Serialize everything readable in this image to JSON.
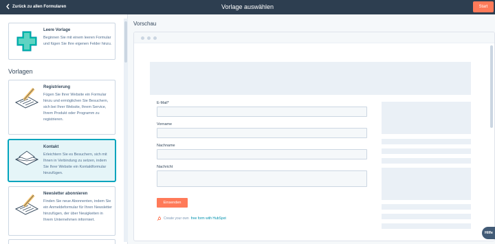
{
  "header": {
    "back_label": "Zurück zu allen Formularen",
    "title": "Vorlage auswählen",
    "start_label": "Start"
  },
  "left": {
    "top_card": {
      "title": "Leere Vorlage",
      "description": "Beginnen Sie mit einem leeren Formular und fügen Sie Ihre eigenen Felder hinzu."
    },
    "section_title": "Vorlagen",
    "cards": [
      {
        "title": "Registrierung",
        "description": "Fügen Sie Ihrer Website ein Formular hinzu und ermöglichen Sie Besuchern, sich bei Ihrer Website, Ihrem Service, Ihrem Produkt oder Programm zu registrieren."
      },
      {
        "title": "Kontakt",
        "description": "Erleichtern Sie es Besuchern, sich mit Ihnen in Verbindung zu setzen, indem Sie Ihrer Website ein Kontaktformular hinzufügen."
      },
      {
        "title": "Newsletter abonnieren",
        "description": "Finden Sie neue Abonnenten, indem Sie ein Anmeldeformular für Ihren Newsletter hinzufügen, der über Neuigkeiten in Ihrem Unternehmen informiert."
      }
    ]
  },
  "preview": {
    "heading": "Vorschau",
    "fields": [
      "E-Mail*",
      "Vorname",
      "Nachname",
      "Nachricht"
    ],
    "submit_label": "Einsenden",
    "credit_prefix": "Create your own",
    "credit_link": "free form with HubSpot"
  },
  "help_label": "Hilfe",
  "colors": {
    "header": "#2d3e50",
    "accent": "#ff7a59",
    "selected": "#00a4bd"
  }
}
